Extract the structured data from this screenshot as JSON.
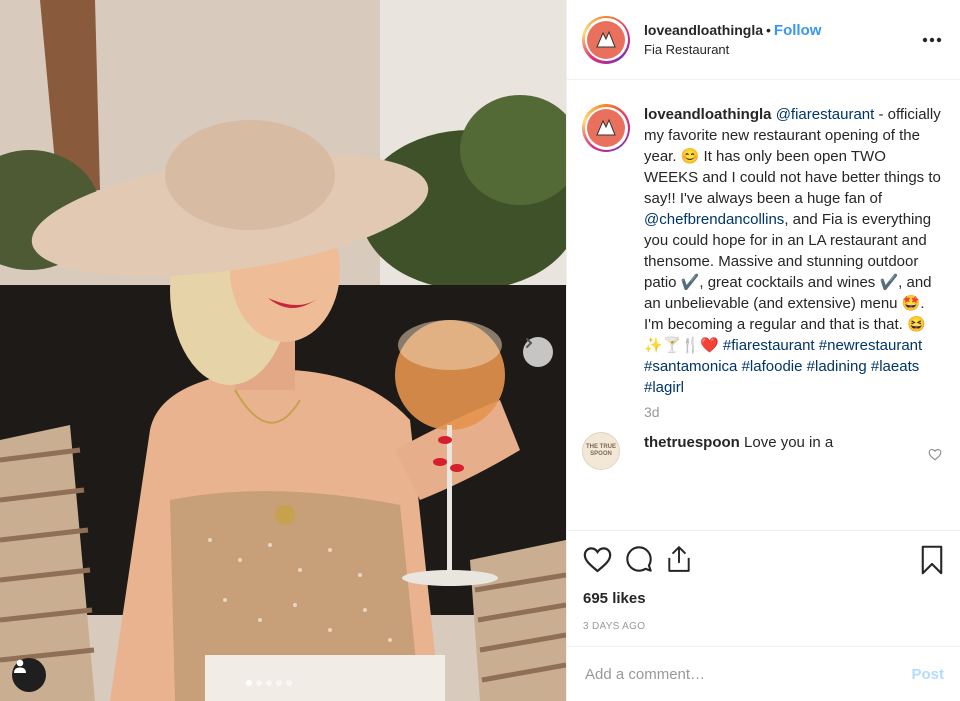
{
  "post": {
    "username": "loveandloathingla",
    "follow_label": "Follow",
    "location": "Fia Restaurant",
    "more_icon": "more-horizontal-icon"
  },
  "caption": {
    "username": "loveandloathingla",
    "mention_restaurant": "@fiarestaurant",
    "text_1": " - officially my favorite new restaurant opening of the year. 😊 It has only been open TWO WEEKS and I could not have better things to say!! I've always been a huge fan of ",
    "mention_chef": "@chefbrendancollins",
    "text_2": ", and Fia is everything you could hope for in an LA restaurant and thensome. Massive and stunning outdoor patio ✔️, great cocktails and wines ✔️, and an unbelievable (and extensive) menu 🤩. I'm becoming a regular and that is that. 😆✨🍸🍴❤️ ",
    "hashtag_1": "#fiarestaurant",
    "hashtag_2": "#newrestaurant",
    "hashtag_3": "#santamonica",
    "hashtag_4": "#lafoodie",
    "hashtag_5": "#ladining",
    "hashtag_6": "#laeats",
    "hashtag_7": "#lagirl",
    "age": "3d"
  },
  "comment": {
    "username": "thetruespoon",
    "text": "Love you in a",
    "avatar_text": "THE TRUE SPOON"
  },
  "actions": {
    "likes": "695 likes",
    "posted": "3 DAYS AGO"
  },
  "add_comment": {
    "placeholder": "Add a comment…",
    "post_label": "Post"
  },
  "colors": {
    "link": "#003569",
    "follow": "#3897f0",
    "post_disabled": "#b3dbff",
    "muted": "#999999"
  },
  "carousel": {
    "slide_count": 5,
    "active_index": 0
  }
}
